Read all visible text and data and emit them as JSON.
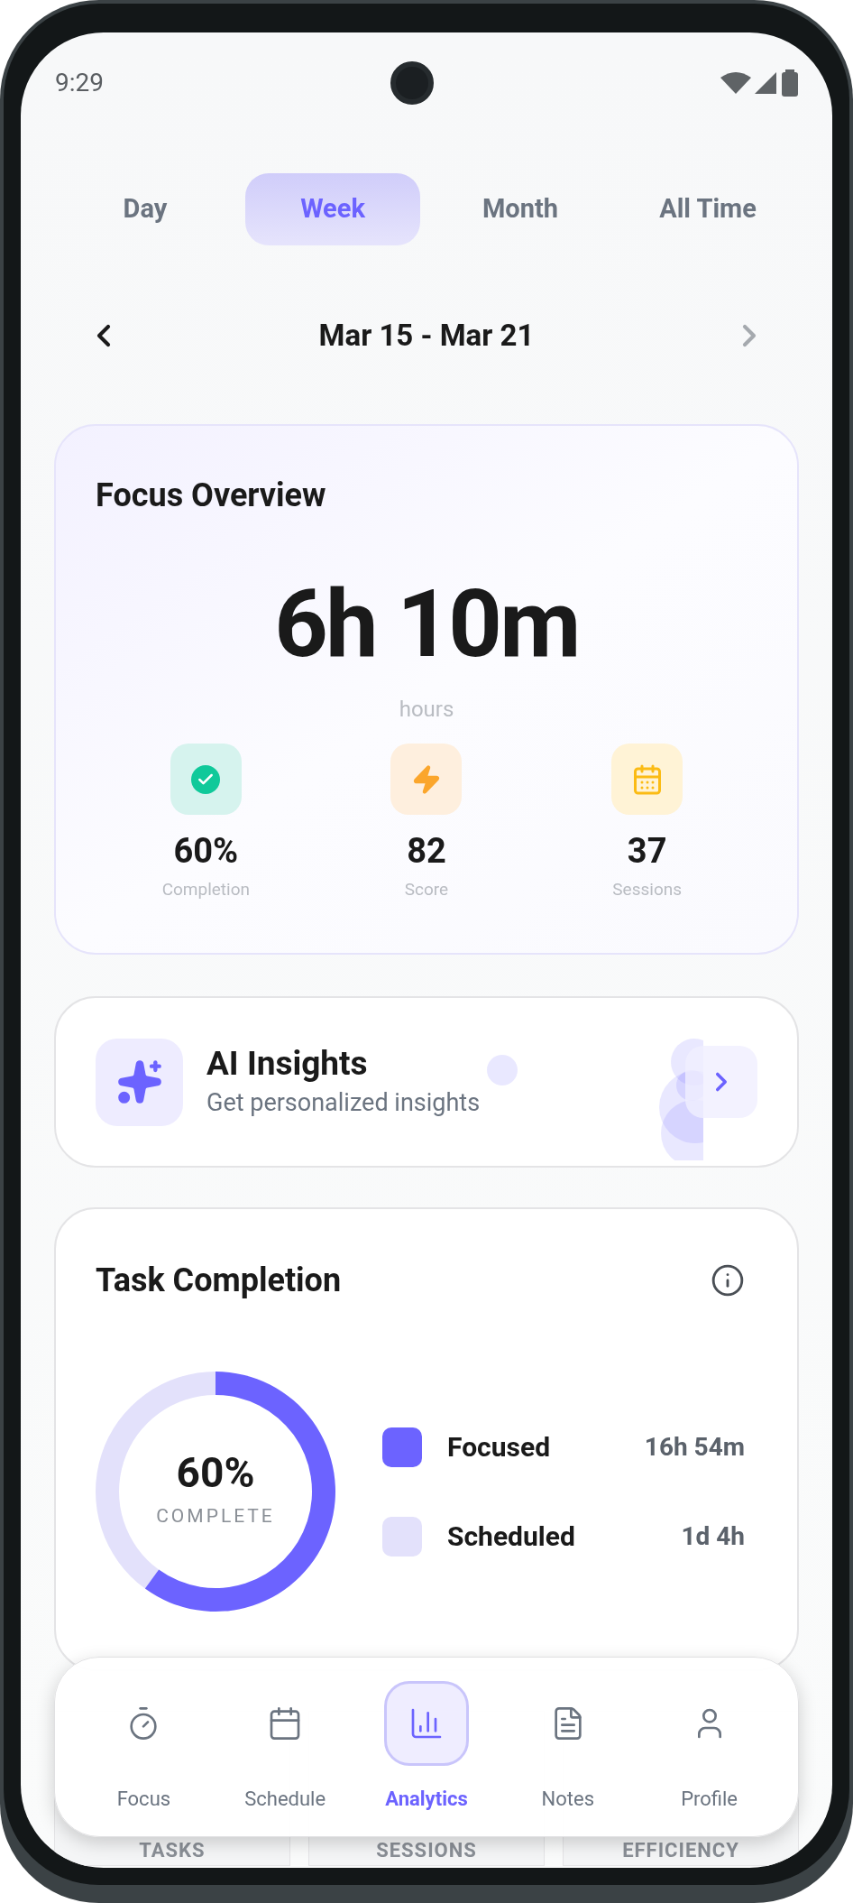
{
  "status_bar": {
    "time": "9:29"
  },
  "period_tabs": [
    {
      "label": "Day",
      "selected": false
    },
    {
      "label": "Week",
      "selected": true
    },
    {
      "label": "Month",
      "selected": false
    },
    {
      "label": "All Time",
      "selected": false
    }
  ],
  "date_range": {
    "label": "Mar 15 - Mar 21",
    "next_disabled": true
  },
  "focus_overview": {
    "title": "Focus Overview",
    "total": "6h 10m",
    "unit": "hours",
    "stats": [
      {
        "kind": "check",
        "value": "60%",
        "label": "Completion",
        "color": "#10c99a"
      },
      {
        "kind": "bolt",
        "value": "82",
        "label": "Score",
        "color": "#fba62c"
      },
      {
        "kind": "calendar",
        "value": "37",
        "label": "Sessions",
        "color": "#fbbb14"
      }
    ]
  },
  "ai_insights": {
    "title": "AI Insights",
    "subtitle": "Get personalized insights"
  },
  "task_completion": {
    "title": "Task Completion",
    "chart_data": {
      "type": "donut",
      "values": [
        60,
        40
      ]
    },
    "percent": "60%",
    "caption": "COMPLETE",
    "legend": [
      {
        "label": "Focused",
        "value": "16h 54m",
        "color": "#6c63ff"
      },
      {
        "label": "Scheduled",
        "value": "1d 4h",
        "color": "#e3e1fb"
      }
    ]
  },
  "summary_cards": [
    {
      "label": "TASKS"
    },
    {
      "label": "SESSIONS"
    },
    {
      "label": "EFFICIENCY"
    }
  ],
  "bottom_nav": [
    {
      "kind": "focus",
      "label": "Focus",
      "selected": false
    },
    {
      "kind": "schedule",
      "label": "Schedule",
      "selected": false
    },
    {
      "kind": "analytics",
      "label": "Analytics",
      "selected": true
    },
    {
      "kind": "notes",
      "label": "Notes",
      "selected": false
    },
    {
      "kind": "profile",
      "label": "Profile",
      "selected": false
    }
  ]
}
